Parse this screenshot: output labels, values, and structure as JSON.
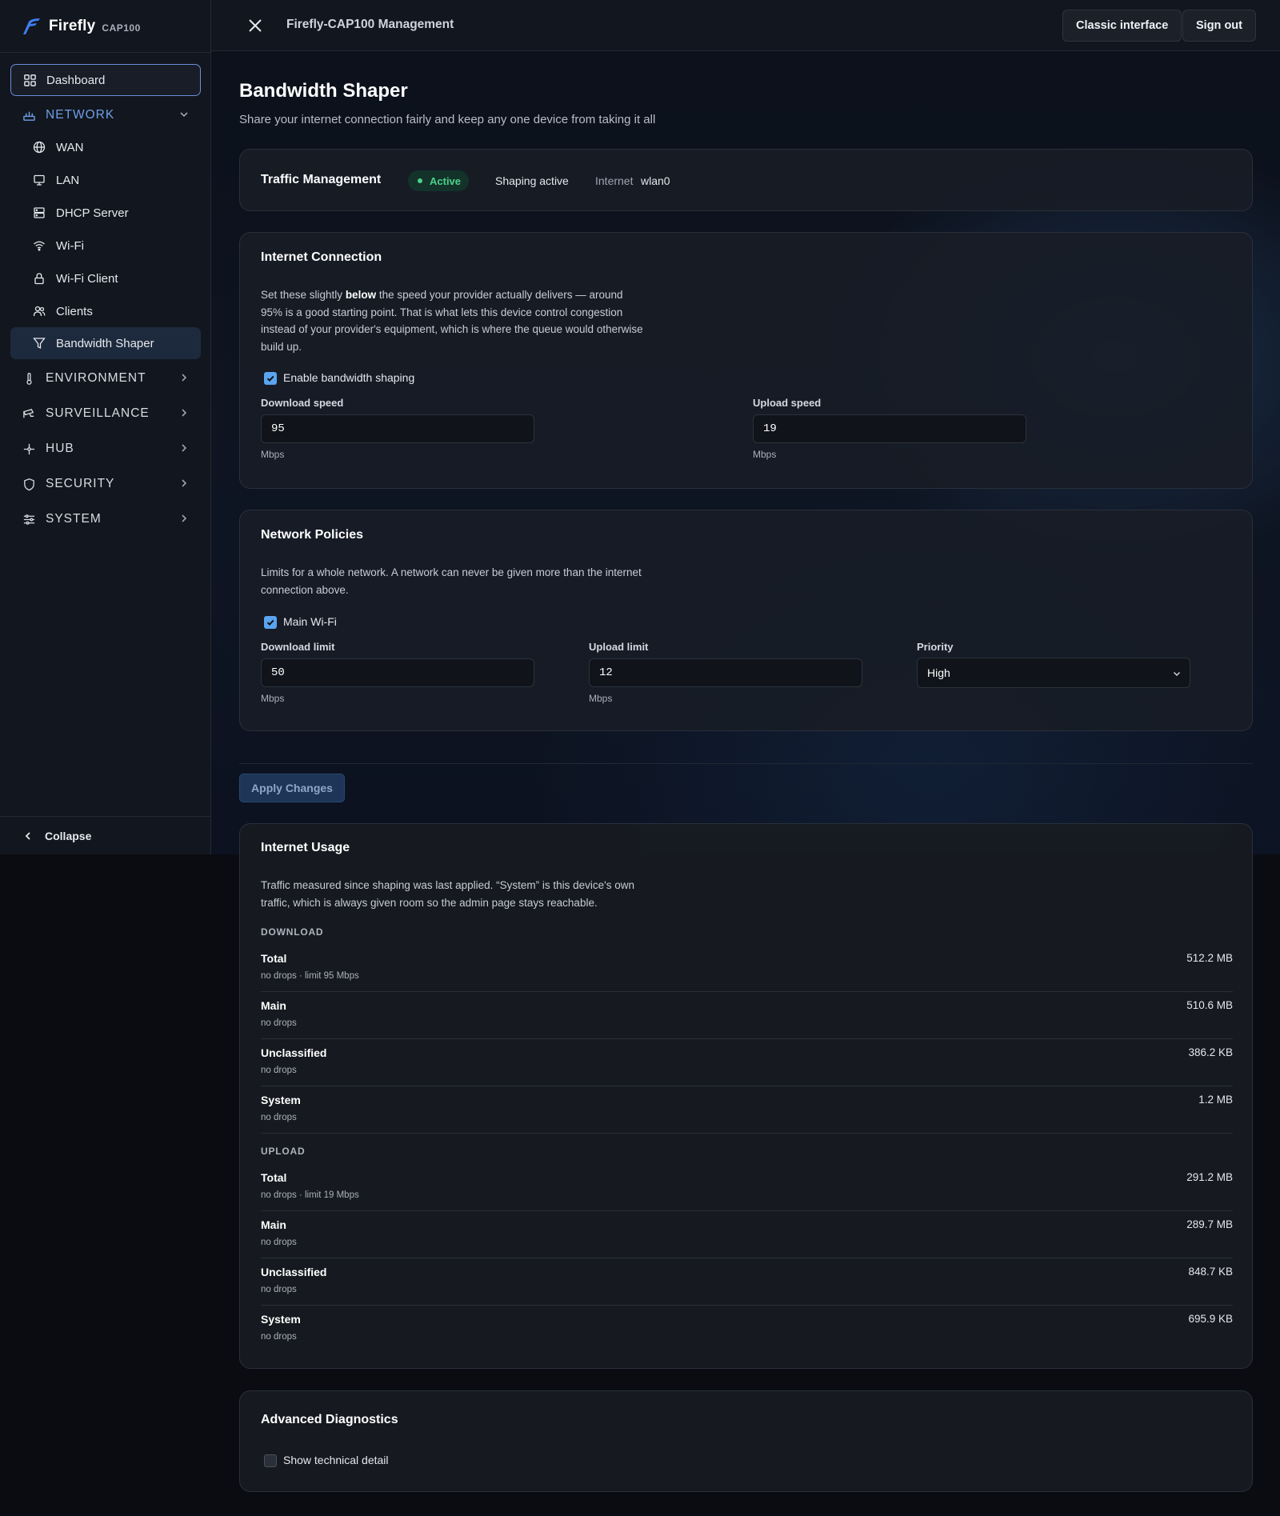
{
  "brand": {
    "name": "Firefly",
    "model": "CAP100"
  },
  "topbar": {
    "title": "Firefly-CAP100 Management",
    "classic_label": "Classic interface",
    "signout_label": "Sign out"
  },
  "sidebar": {
    "dashboard": "Dashboard",
    "network": {
      "label": "NETWORK",
      "items": [
        {
          "label": "WAN",
          "icon": "globe-icon"
        },
        {
          "label": "LAN",
          "icon": "monitor-icon"
        },
        {
          "label": "DHCP Server",
          "icon": "server-icon"
        },
        {
          "label": "Wi-Fi",
          "icon": "wifi-icon"
        },
        {
          "label": "Wi-Fi Client",
          "icon": "lock-icon"
        },
        {
          "label": "Clients",
          "icon": "users-icon"
        },
        {
          "label": "Bandwidth Shaper",
          "icon": "filter-icon"
        }
      ]
    },
    "sections": [
      {
        "label": "ENVIRONMENT",
        "icon": "thermometer-icon"
      },
      {
        "label": "SURVEILLANCE",
        "icon": "camera-icon"
      },
      {
        "label": "HUB",
        "icon": "hub-icon"
      },
      {
        "label": "SECURITY",
        "icon": "shield-icon"
      },
      {
        "label": "SYSTEM",
        "icon": "sliders-icon"
      }
    ],
    "collapse": "Collapse"
  },
  "page": {
    "title": "Bandwidth Shaper",
    "subtitle": "Share your internet connection fairly and keep any one device from taking it all"
  },
  "traffic": {
    "title": "Traffic Management",
    "badge": "Active",
    "status": "Shaping active",
    "internet_label": "Internet",
    "internet_value": "wlan0"
  },
  "connection": {
    "title": "Internet Connection",
    "desc_before": "Set these slightly ",
    "desc_bold": "below",
    "desc_after": " the speed your provider actually delivers — around 95% is a good starting point. That is what lets this device control congestion instead of your provider's equipment, which is where the queue would otherwise build up.",
    "enable_label": "Enable bandwidth shaping",
    "enable_checked": true,
    "download_label": "Download speed",
    "download_value": "95",
    "upload_label": "Upload speed",
    "upload_value": "19",
    "unit": "Mbps"
  },
  "policies": {
    "title": "Network Policies",
    "desc": "Limits for a whole network. A network can never be given more than the internet connection above.",
    "network_label": "Main Wi-Fi",
    "network_checked": true,
    "download_label": "Download limit",
    "download_value": "50",
    "upload_label": "Upload limit",
    "upload_value": "12",
    "priority_label": "Priority",
    "priority_value": "High",
    "unit": "Mbps"
  },
  "apply_label": "Apply Changes",
  "usage": {
    "title": "Internet Usage",
    "desc": "Traffic measured since shaping was last applied. “System” is this device's own traffic, which is always given room so the admin page stays reachable.",
    "download_head": "DOWNLOAD",
    "download": [
      {
        "name": "Total",
        "note": "no drops · limit 95 Mbps",
        "value": "512.2 MB"
      },
      {
        "name": "Main",
        "note": "no drops",
        "value": "510.6 MB"
      },
      {
        "name": "Unclassified",
        "note": "no drops",
        "value": "386.2 KB"
      },
      {
        "name": "System",
        "note": "no drops",
        "value": "1.2 MB"
      }
    ],
    "upload_head": "UPLOAD",
    "upload": [
      {
        "name": "Total",
        "note": "no drops · limit 19 Mbps",
        "value": "291.2 MB"
      },
      {
        "name": "Main",
        "note": "no drops",
        "value": "289.7 MB"
      },
      {
        "name": "Unclassified",
        "note": "no drops",
        "value": "848.7 KB"
      },
      {
        "name": "System",
        "note": "no drops",
        "value": "695.9 KB"
      }
    ]
  },
  "diagnostics": {
    "title": "Advanced Diagnostics",
    "toggle_label": "Show technical detail",
    "toggle_checked": false
  },
  "colors": {
    "accent": "#6fa0e8",
    "active_green": "#4ed08a",
    "checkbox": "#5aa4ef"
  }
}
